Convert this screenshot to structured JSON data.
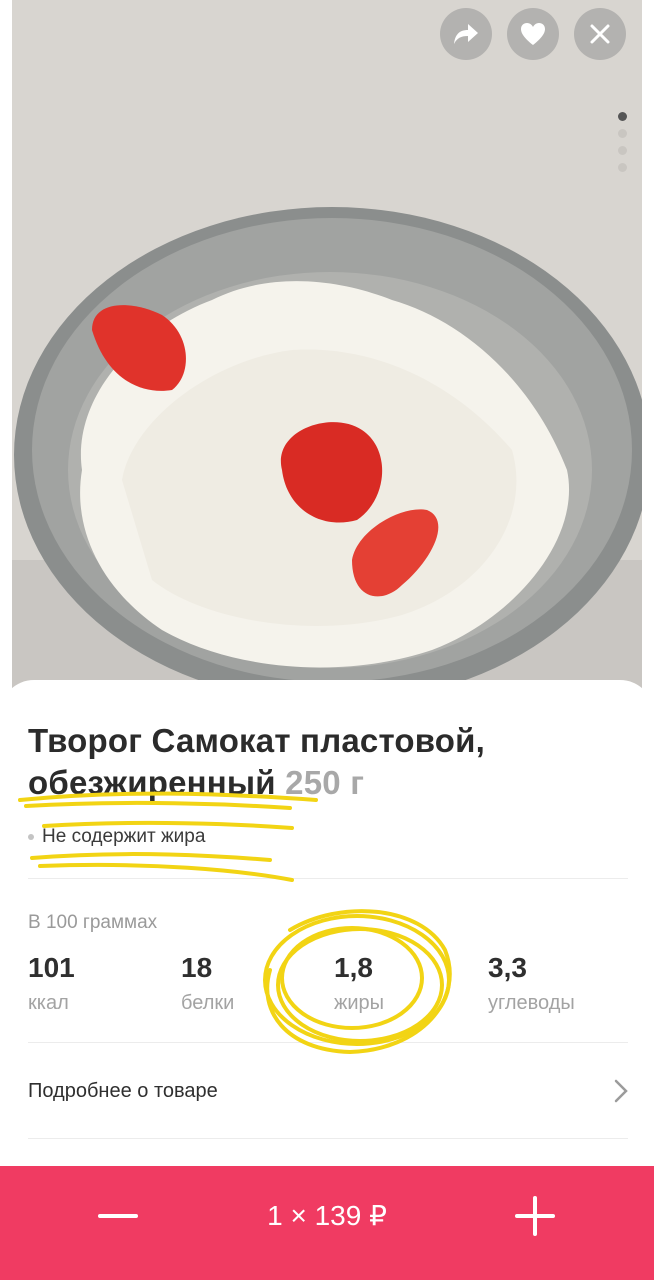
{
  "product": {
    "title_line1": "Творог Самокат пластовой,",
    "title_line2": "обезжиренный",
    "weight": "250 г",
    "tag": "Не содержит жира"
  },
  "nutrition": {
    "header": "В 100 граммах",
    "items": [
      {
        "value": "101",
        "label": "ккал"
      },
      {
        "value": "18",
        "label": "белки"
      },
      {
        "value": "1,8",
        "label": "жиры"
      },
      {
        "value": "3,3",
        "label": "углеводы"
      }
    ]
  },
  "details_link": "Подробнее о товаре",
  "cart": {
    "price_label": "1 × 139 ₽"
  },
  "gallery": {
    "active_index": 0,
    "count": 4
  },
  "icons": {
    "share": "share-icon",
    "favorite": "heart-icon",
    "close": "close-icon",
    "minus": "minus-icon",
    "plus": "plus-icon",
    "chevron": "chevron-right-icon"
  },
  "colors": {
    "accent": "#f03b62",
    "highlight_scribble": "#f2d414"
  }
}
